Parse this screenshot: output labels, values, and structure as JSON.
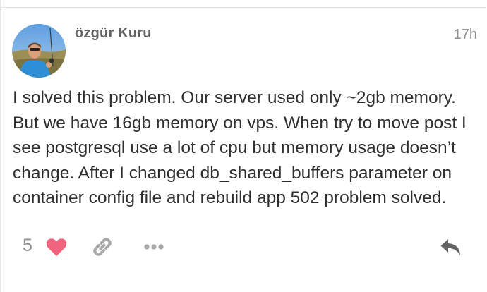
{
  "post": {
    "author": "özgür Kuru",
    "date": "17h",
    "body": "I solved this problem. Our server used only ~2gb memory. But we have 16gb memory on vps. When try to move post I see postgresql use a lot of cpu but memory usage doesn’t change. After I changed db_shared_buffers parameter on container config file and rebuild app 502 problem solved.",
    "like_count": "5"
  },
  "icons": {
    "like": "heart-icon",
    "link": "link-icon",
    "more": "ellipsis-icon",
    "reply": "reply-icon"
  },
  "colors": {
    "heart": "#f0647d",
    "icon_gray": "#a8a8a8",
    "reply": "#646464",
    "body_text": "#2f2f2f",
    "username": "#646464",
    "meta_text": "#8f8f8f"
  }
}
